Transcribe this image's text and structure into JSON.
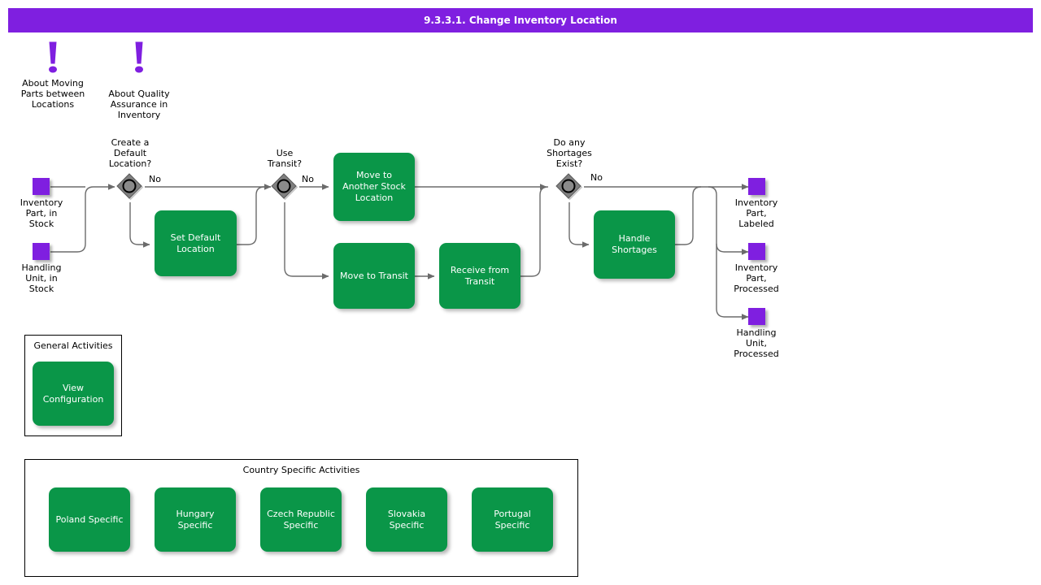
{
  "header": {
    "title": "9.3.3.1. Change Inventory Location"
  },
  "annotations": [
    {
      "icon": "exclamation-icon",
      "label": "About Moving\nParts between\nLocations"
    },
    {
      "icon": "exclamation-icon",
      "label": "About Quality\nAssurance in\nInventory"
    }
  ],
  "inputs": [
    {
      "label": "Inventory\nPart, in\nStock"
    },
    {
      "label": "Handling\nUnit, in\nStock"
    }
  ],
  "outputs": [
    {
      "label": "Inventory\nPart,\nLabeled"
    },
    {
      "label": "Inventory\nPart,\nProcessed"
    },
    {
      "label": "Handling\nUnit,\nProcessed"
    }
  ],
  "gateways": [
    {
      "label": "Create a\nDefault\nLocation?",
      "flow_label": "No"
    },
    {
      "label": "Use\nTransit?",
      "flow_label": "No"
    },
    {
      "label": "Do any\nShortages\nExist?",
      "flow_label": "No"
    }
  ],
  "tasks": [
    {
      "label": "Set Default\nLocation"
    },
    {
      "label": "Move to Another\nStock Location"
    },
    {
      "label": "Move to Transit"
    },
    {
      "label": "Receive from\nTransit"
    },
    {
      "label": "Handle\nShortages"
    }
  ],
  "general_group": {
    "title": "General Activities",
    "tasks": [
      {
        "label": "View\nConfiguration"
      }
    ]
  },
  "country_group": {
    "title": "Country Specific Activities",
    "tasks": [
      {
        "label": "Poland Specific"
      },
      {
        "label": "Hungary Specific"
      },
      {
        "label": "Czech Republic\nSpecific"
      },
      {
        "label": "Slovakia\nSpecific"
      },
      {
        "label": "Portugal Specific"
      }
    ]
  },
  "colors": {
    "accent_purple": "#7F1FE0",
    "task_green": "#0A9648",
    "gateway_gray": "#808080",
    "connector_gray": "#666666"
  }
}
